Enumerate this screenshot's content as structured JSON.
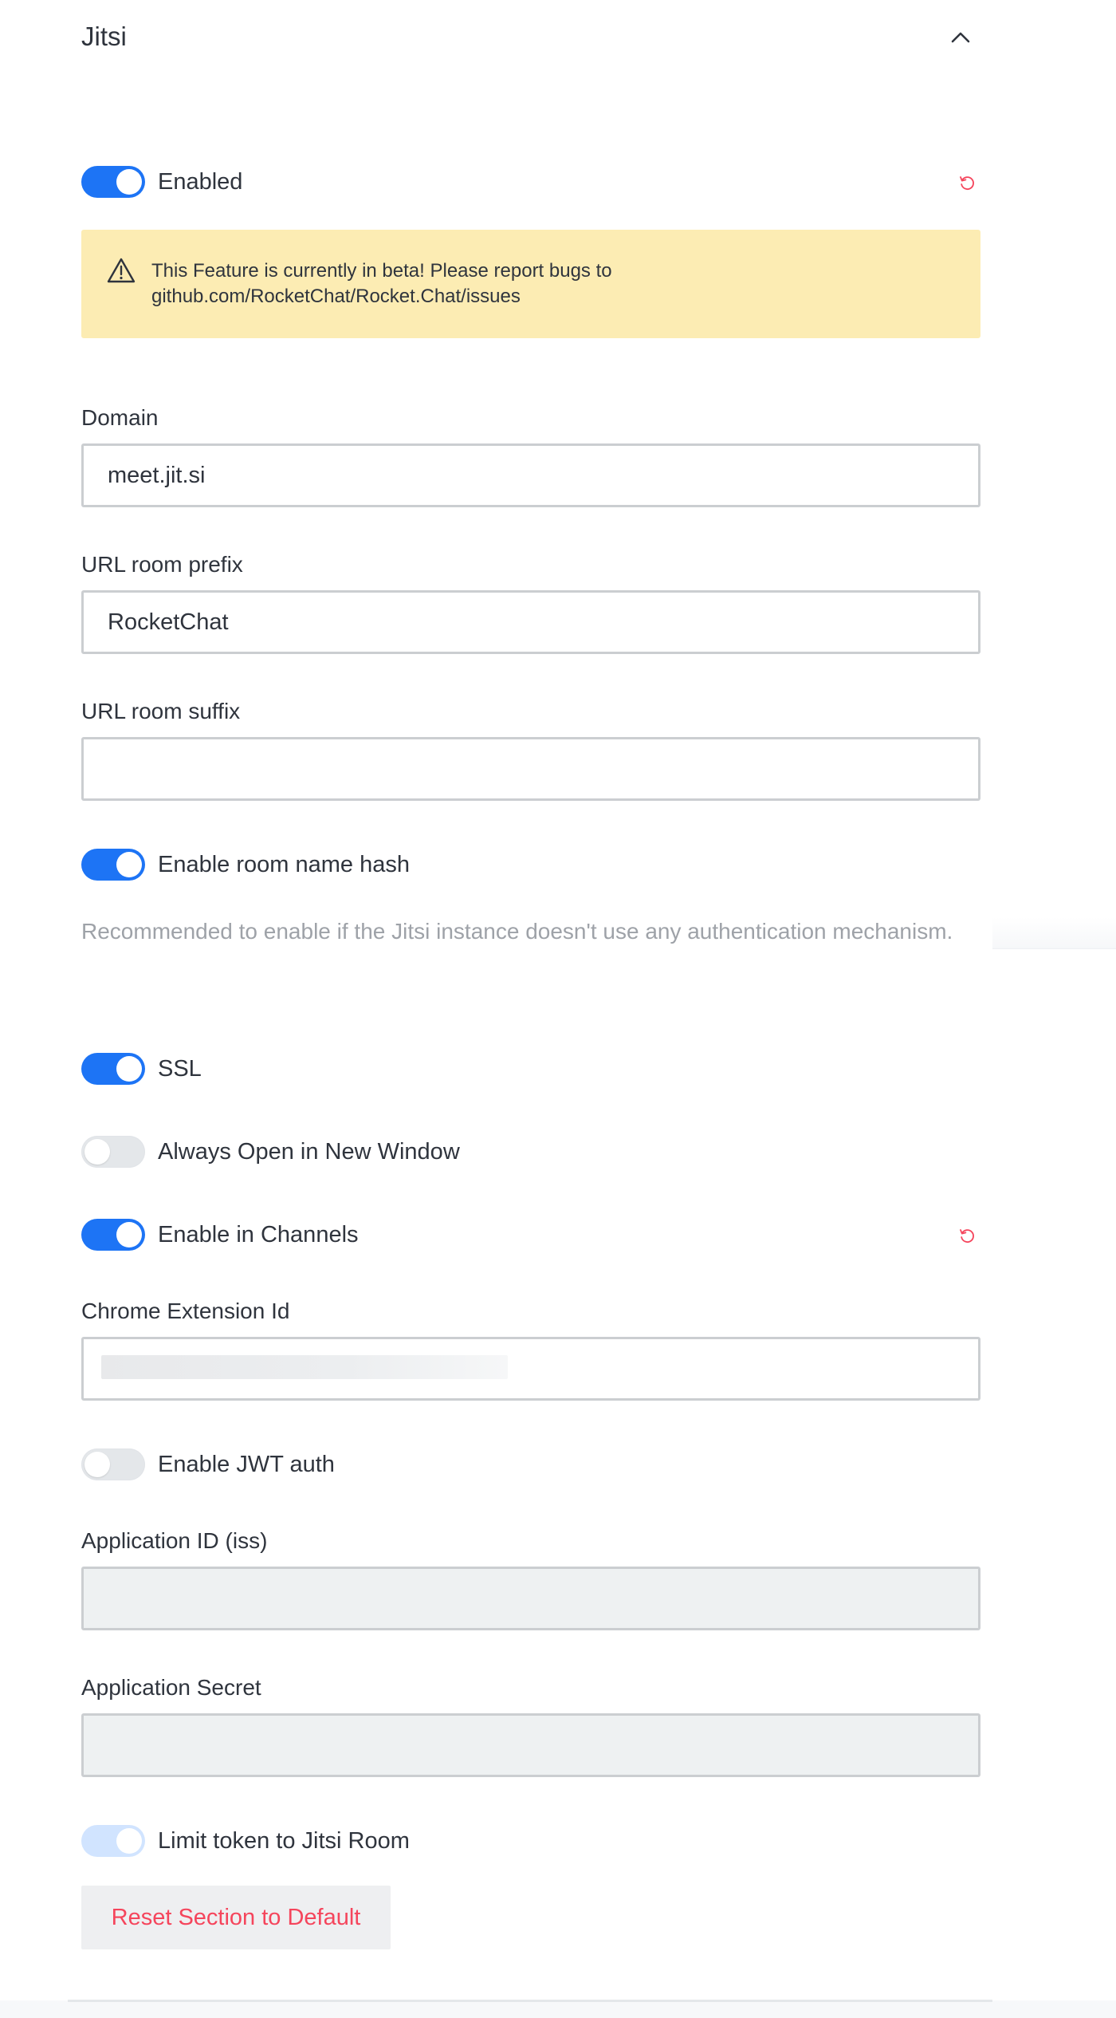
{
  "section": {
    "title": "Jitsi",
    "collapse_icon": "chevron-up-icon"
  },
  "colors": {
    "accent": "#1d74f5",
    "toggle_off": "#e4e7ea",
    "reset": "#f5455c",
    "callout_bg": "#fcecb3",
    "hint_text": "#9ea2a8"
  },
  "settings": {
    "enabled": {
      "label": "Enabled",
      "on": true,
      "reset_icon": "reset-icon"
    },
    "beta_notice": {
      "icon": "warning-icon",
      "line1": "This Feature is currently in beta! Please report bugs to",
      "line2": "github.com/RocketChat/Rocket.Chat/issues"
    },
    "domain": {
      "label": "Domain",
      "value": "meet.jit.si"
    },
    "url_room_prefix": {
      "label": "URL room prefix",
      "value": "RocketChat"
    },
    "url_room_suffix": {
      "label": "URL room suffix",
      "value": ""
    },
    "enable_room_name_hash": {
      "label": "Enable room name hash",
      "on": true,
      "hint": "Recommended to enable if the Jitsi instance doesn't use any authentication mechanism."
    },
    "ssl": {
      "label": "SSL",
      "on": true
    },
    "always_open_new_window": {
      "label": "Always Open in New Window",
      "on": false
    },
    "enable_in_channels": {
      "label": "Enable in Channels",
      "on": true,
      "reset_icon": "reset-icon"
    },
    "chrome_extension_id": {
      "label": "Chrome Extension Id",
      "value_obscured": true
    },
    "enable_jwt_auth": {
      "label": "Enable JWT auth",
      "on": false
    },
    "application_id": {
      "label": "Application ID (iss)",
      "value": "",
      "disabled": true
    },
    "application_secret": {
      "label": "Application Secret",
      "value": "",
      "disabled": true
    },
    "limit_token_to_room": {
      "label": "Limit token to Jitsi Room",
      "on": true,
      "disabled": true
    }
  },
  "actions": {
    "reset_section_label": "Reset Section to Default"
  }
}
